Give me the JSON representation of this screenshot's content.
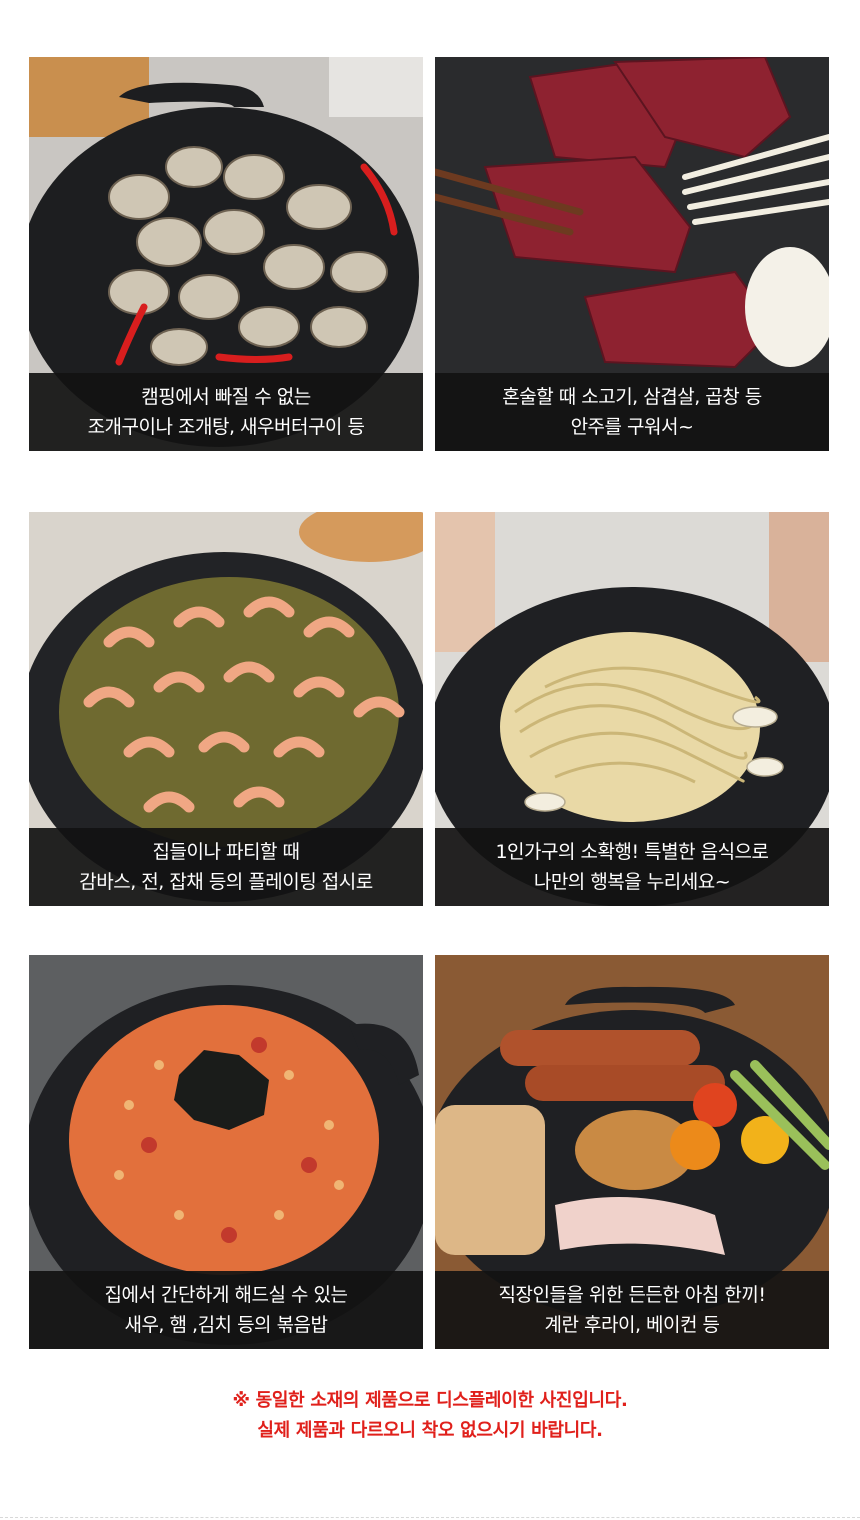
{
  "cards": [
    {
      "name": "clams",
      "caption": [
        "캠핑에서 빠질 수 없는",
        "조개구이나 조개탕, 새우버터구이 등"
      ]
    },
    {
      "name": "beef",
      "caption": [
        "혼술할 때 소고기, 삼겹살, 곱창 등",
        "안주를 구워서~"
      ]
    },
    {
      "name": "shrimp",
      "caption": [
        "집들이나 파티할 때",
        "감바스, 전, 잡채 등의 플레이팅 접시로"
      ]
    },
    {
      "name": "pasta",
      "caption": [
        "1인가구의 소확행! 특별한 음식으로",
        "나만의 행복을 누리세요~"
      ]
    },
    {
      "name": "fried-rice",
      "caption": [
        "집에서 간단하게 해드실 수 있는",
        "새우, 햄 ,김치 등의 볶음밥"
      ]
    },
    {
      "name": "breakfast",
      "caption": [
        "직장인들을 위한 든든한 아침 한끼!",
        "계란 후라이, 베이컨 등"
      ]
    }
  ],
  "notice": {
    "line1": "※ 동일한 소재의 제품으로 디스플레이한 사진입니다.",
    "line2": "실제 제품과 다르오니 착오 없으시기 바랍니다."
  },
  "colors": {
    "caption_bg": "#121212",
    "notice_red": "#e0201b",
    "griddle": "#1c1d1f"
  },
  "icons": {
    "notice_mark": "reference-mark"
  }
}
